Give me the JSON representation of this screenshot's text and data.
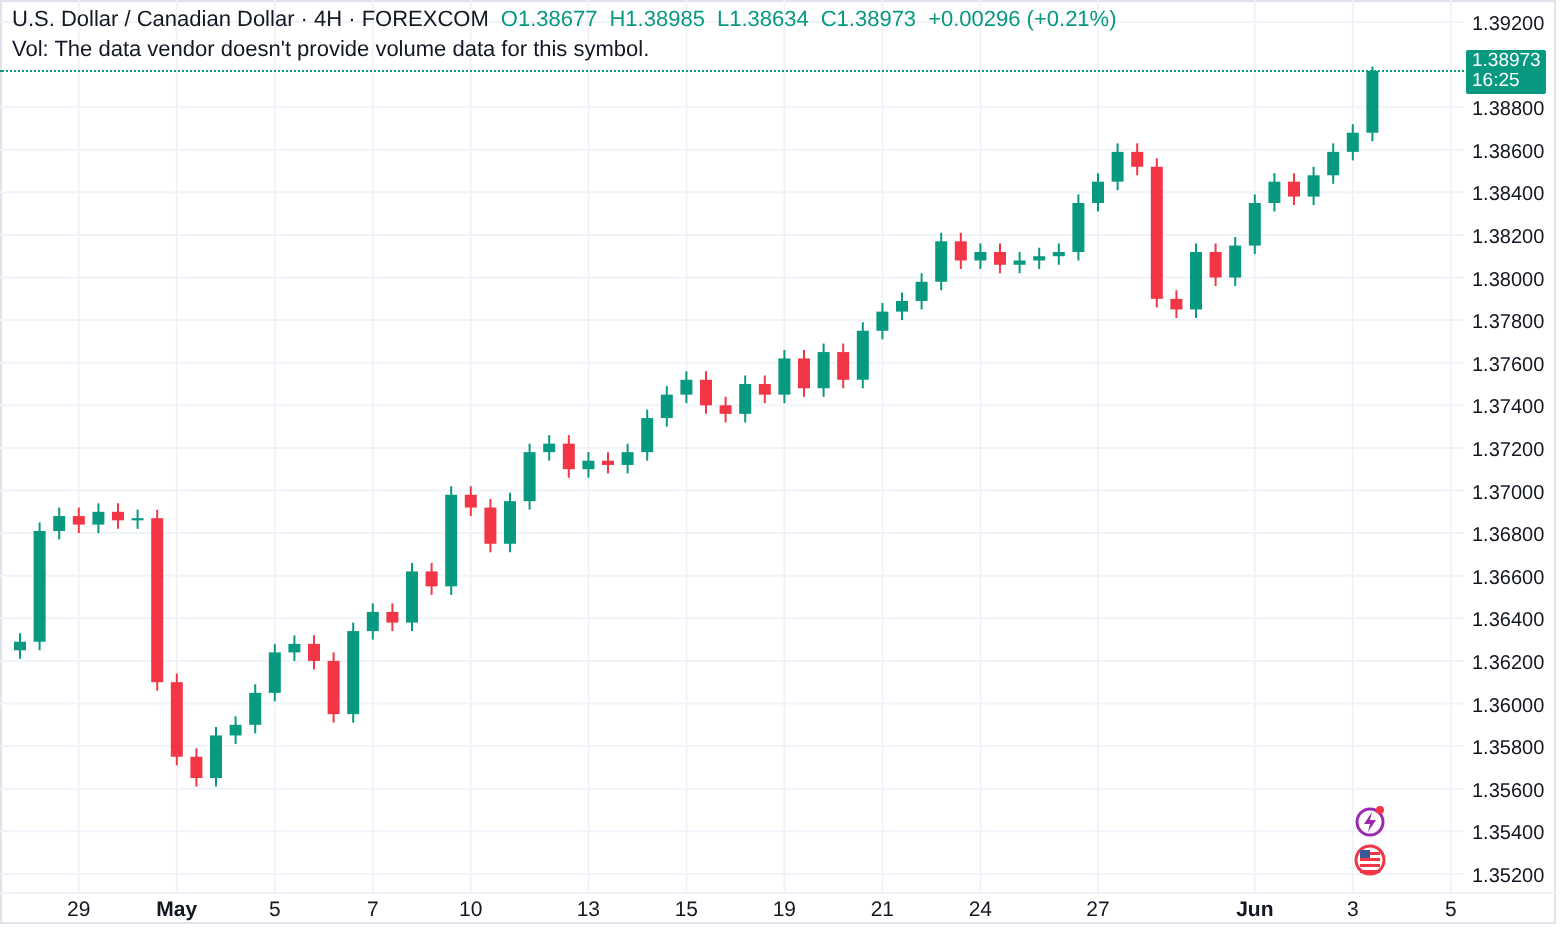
{
  "legend": {
    "symbol": "U.S. Dollar / Canadian Dollar · 4H · FOREXCOM",
    "ohlc": [
      "O1.38677",
      "H1.38985",
      "L1.38634",
      "C1.38973"
    ],
    "change": "+0.00296 (+0.21%)",
    "volume_note": "Vol: The data vendor doesn't provide volume data for this symbol."
  },
  "last_price": {
    "price": "1.38973",
    "countdown": "16:25"
  },
  "chart": {
    "chart_data": {
      "type": "candlestick",
      "grid": true,
      "ylim": [
        1.35115,
        1.39303
      ],
      "categories": [
        null,
        null,
        null,
        "29",
        null,
        null,
        null,
        null,
        "May",
        null,
        null,
        null,
        null,
        "5",
        null,
        null,
        null,
        null,
        "7",
        null,
        null,
        null,
        null,
        "10",
        null,
        null,
        null,
        null,
        null,
        "13",
        null,
        null,
        null,
        null,
        "15",
        null,
        null,
        null,
        null,
        "19",
        null,
        null,
        null,
        null,
        "21",
        null,
        null,
        null,
        null,
        "24",
        null,
        null,
        null,
        null,
        null,
        "27",
        null,
        null,
        null,
        null,
        null,
        null,
        null,
        "Jun",
        null,
        null,
        null,
        null,
        "3",
        null,
        null,
        null,
        null,
        "5"
      ],
      "ohlc": [
        [
          1.3625,
          1.3633,
          1.3621,
          1.3629
        ],
        [
          1.3629,
          1.3685,
          1.3625,
          1.3681
        ],
        [
          1.3681,
          1.3692,
          1.3677,
          1.3688
        ],
        [
          1.3688,
          1.3692,
          1.368,
          1.3684
        ],
        [
          1.3684,
          1.3694,
          1.368,
          1.369
        ],
        [
          1.369,
          1.3694,
          1.3682,
          1.3686
        ],
        [
          1.3686,
          1.3691,
          1.3682,
          1.3687
        ],
        [
          1.3687,
          1.3691,
          1.3606,
          1.361
        ],
        [
          1.361,
          1.3614,
          1.3571,
          1.3575
        ],
        [
          1.3575,
          1.3579,
          1.3561,
          1.3565
        ],
        [
          1.3565,
          1.3589,
          1.3561,
          1.3585
        ],
        [
          1.3585,
          1.3594,
          1.3581,
          1.359
        ],
        [
          1.359,
          1.3609,
          1.3586,
          1.3605
        ],
        [
          1.3605,
          1.3628,
          1.3601,
          1.3624
        ],
        [
          1.3624,
          1.3632,
          1.362,
          1.3628
        ],
        [
          1.3628,
          1.3632,
          1.3616,
          1.362
        ],
        [
          1.362,
          1.3624,
          1.3591,
          1.3595
        ],
        [
          1.3595,
          1.3638,
          1.3591,
          1.3634
        ],
        [
          1.3634,
          1.3647,
          1.363,
          1.3643
        ],
        [
          1.3643,
          1.3647,
          1.3634,
          1.3638
        ],
        [
          1.3638,
          1.3666,
          1.3634,
          1.3662
        ],
        [
          1.3662,
          1.3666,
          1.3651,
          1.3655
        ],
        [
          1.3655,
          1.3702,
          1.3651,
          1.3698
        ],
        [
          1.3698,
          1.3702,
          1.3688,
          1.3692
        ],
        [
          1.3692,
          1.3696,
          1.3671,
          1.3675
        ],
        [
          1.3675,
          1.3699,
          1.3671,
          1.3695
        ],
        [
          1.3695,
          1.3722,
          1.3691,
          1.3718
        ],
        [
          1.3718,
          1.3726,
          1.3714,
          1.3722
        ],
        [
          1.3722,
          1.3726,
          1.3706,
          1.371
        ],
        [
          1.371,
          1.3718,
          1.3706,
          1.3714
        ],
        [
          1.3714,
          1.3718,
          1.3708,
          1.3712
        ],
        [
          1.3712,
          1.3722,
          1.3708,
          1.3718
        ],
        [
          1.3718,
          1.3738,
          1.3714,
          1.3734
        ],
        [
          1.3734,
          1.3749,
          1.373,
          1.3745
        ],
        [
          1.3745,
          1.3756,
          1.3741,
          1.3752
        ],
        [
          1.3752,
          1.3756,
          1.3736,
          1.374
        ],
        [
          1.374,
          1.3744,
          1.3732,
          1.3736
        ],
        [
          1.3736,
          1.3754,
          1.3732,
          1.375
        ],
        [
          1.375,
          1.3754,
          1.3741,
          1.3745
        ],
        [
          1.3745,
          1.3766,
          1.3741,
          1.3762
        ],
        [
          1.3762,
          1.3766,
          1.3744,
          1.3748
        ],
        [
          1.3748,
          1.3769,
          1.3744,
          1.3765
        ],
        [
          1.3765,
          1.3769,
          1.3748,
          1.3752
        ],
        [
          1.3752,
          1.3779,
          1.3748,
          1.3775
        ],
        [
          1.3775,
          1.3788,
          1.3771,
          1.3784
        ],
        [
          1.3784,
          1.3793,
          1.378,
          1.3789
        ],
        [
          1.3789,
          1.3802,
          1.3785,
          1.3798
        ],
        [
          1.3798,
          1.3821,
          1.3794,
          1.3817
        ],
        [
          1.3817,
          1.3821,
          1.3804,
          1.3808
        ],
        [
          1.3808,
          1.3816,
          1.3804,
          1.3812
        ],
        [
          1.3812,
          1.3816,
          1.3802,
          1.3806
        ],
        [
          1.3806,
          1.3812,
          1.3802,
          1.3808
        ],
        [
          1.3808,
          1.3814,
          1.3804,
          1.381
        ],
        [
          1.381,
          1.3816,
          1.3806,
          1.3812
        ],
        [
          1.3812,
          1.3839,
          1.3808,
          1.3835
        ],
        [
          1.3835,
          1.3849,
          1.3831,
          1.3845
        ],
        [
          1.3845,
          1.3863,
          1.3841,
          1.3859
        ],
        [
          1.3859,
          1.3863,
          1.3848,
          1.3852
        ],
        [
          1.3852,
          1.3856,
          1.3786,
          1.379
        ],
        [
          1.379,
          1.3794,
          1.3781,
          1.3785
        ],
        [
          1.3785,
          1.3816,
          1.3781,
          1.3812
        ],
        [
          1.3812,
          1.3816,
          1.3796,
          1.38
        ],
        [
          1.38,
          1.3819,
          1.3796,
          1.3815
        ],
        [
          1.3815,
          1.3839,
          1.3811,
          1.3835
        ],
        [
          1.3835,
          1.3849,
          1.3831,
          1.3845
        ],
        [
          1.3845,
          1.3849,
          1.3834,
          1.3838
        ],
        [
          1.3838,
          1.3852,
          1.3834,
          1.3848
        ],
        [
          1.3848,
          1.3863,
          1.3844,
          1.3859
        ],
        [
          1.3859,
          1.3872,
          1.3855,
          1.3868
        ],
        [
          1.3868,
          1.3899,
          1.3864,
          1.3897
        ],
        null,
        null,
        null,
        null
      ],
      "yticks": [
        {
          "value": 1.352,
          "label": "1.35200"
        },
        {
          "value": 1.354,
          "label": "1.35400"
        },
        {
          "value": 1.356,
          "label": "1.35600"
        },
        {
          "value": 1.358,
          "label": "1.35800"
        },
        {
          "value": 1.36,
          "label": "1.36000"
        },
        {
          "value": 1.362,
          "label": "1.36200"
        },
        {
          "value": 1.364,
          "label": "1.36400"
        },
        {
          "value": 1.366,
          "label": "1.36600"
        },
        {
          "value": 1.368,
          "label": "1.36800"
        },
        {
          "value": 1.37,
          "label": "1.37000"
        },
        {
          "value": 1.372,
          "label": "1.37200"
        },
        {
          "value": 1.374,
          "label": "1.37400"
        },
        {
          "value": 1.376,
          "label": "1.37600"
        },
        {
          "value": 1.378,
          "label": "1.37800"
        },
        {
          "value": 1.38,
          "label": "1.38000"
        },
        {
          "value": 1.382,
          "label": "1.38200"
        },
        {
          "value": 1.384,
          "label": "1.38400"
        },
        {
          "value": 1.386,
          "label": "1.38600"
        },
        {
          "value": 1.388,
          "label": "1.38800"
        },
        {
          "value": 1.392,
          "label": "1.39200"
        }
      ]
    }
  }
}
